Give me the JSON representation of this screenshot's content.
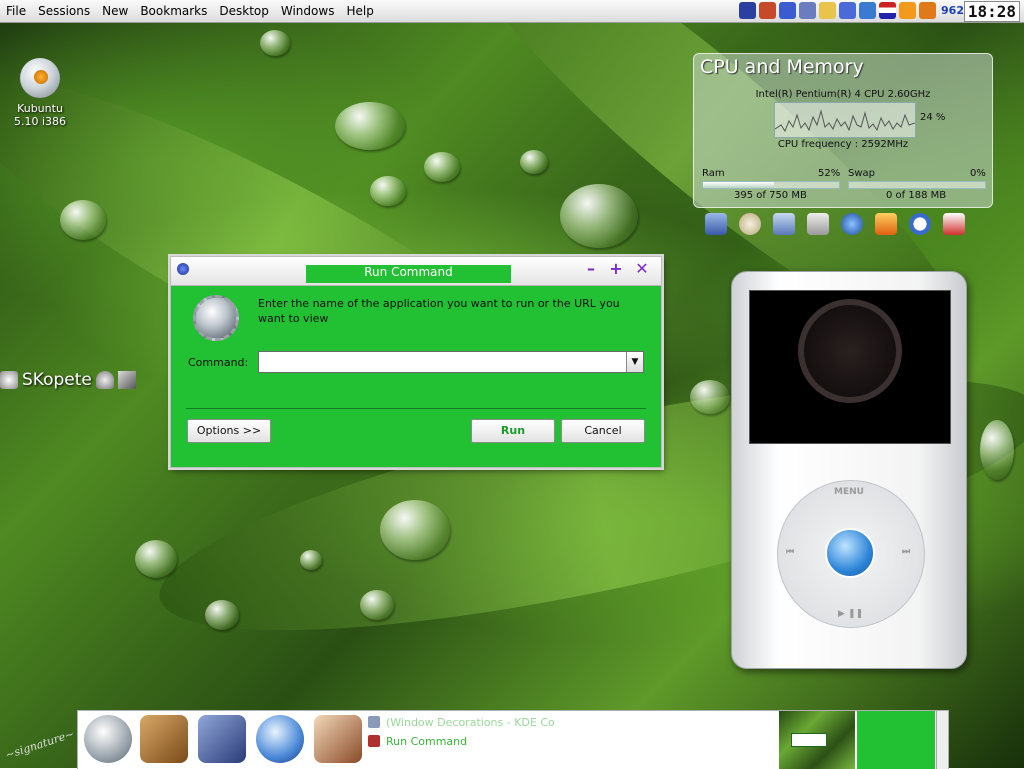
{
  "menubar": {
    "items": [
      "File",
      "Sessions",
      "New",
      "Bookmarks",
      "Desktop",
      "Windows",
      "Help"
    ],
    "tray_count": "962",
    "clock": "18:28"
  },
  "desktop_icon": {
    "label": "Kubuntu 5.10 i386"
  },
  "kopete": {
    "label": "SKopete"
  },
  "cpu_widget": {
    "title": "CPU and Memory",
    "cpu_model": "Intel(R) Pentium(R) 4 CPU 2.60GHz",
    "cpu_percent": "24 %",
    "cpu_load": 0.24,
    "cpu_frequency": "CPU frequency : 2592MHz",
    "ram_label": "Ram",
    "ram_percent": "52%",
    "ram_fraction": 0.52,
    "ram_usage": "395 of 750 MB",
    "swap_label": "Swap",
    "swap_percent": "0%",
    "swap_fraction": 0,
    "swap_usage": "0 of 188 MB"
  },
  "dialog": {
    "title": "Run Command",
    "prompt": "Enter the name of the application you want to run or the URL you want to view",
    "command_label": "Command:",
    "command_value": "",
    "options_button": "Options >>",
    "run_button": "Run",
    "cancel_button": "Cancel"
  },
  "ipod": {
    "menu_label": "MENU",
    "prev_label": "⏮",
    "next_label": "⏭",
    "playpause_label": "▶ ❚❚"
  },
  "taskbar": {
    "tasks": [
      {
        "label": "(Window Decorations - KDE Co",
        "icon": "preferences-icon"
      },
      {
        "label": "Run Command",
        "icon": "run-command-icon"
      }
    ]
  },
  "colors": {
    "dialog_green": "#22c033",
    "task_text_green": "#3ab43a"
  }
}
